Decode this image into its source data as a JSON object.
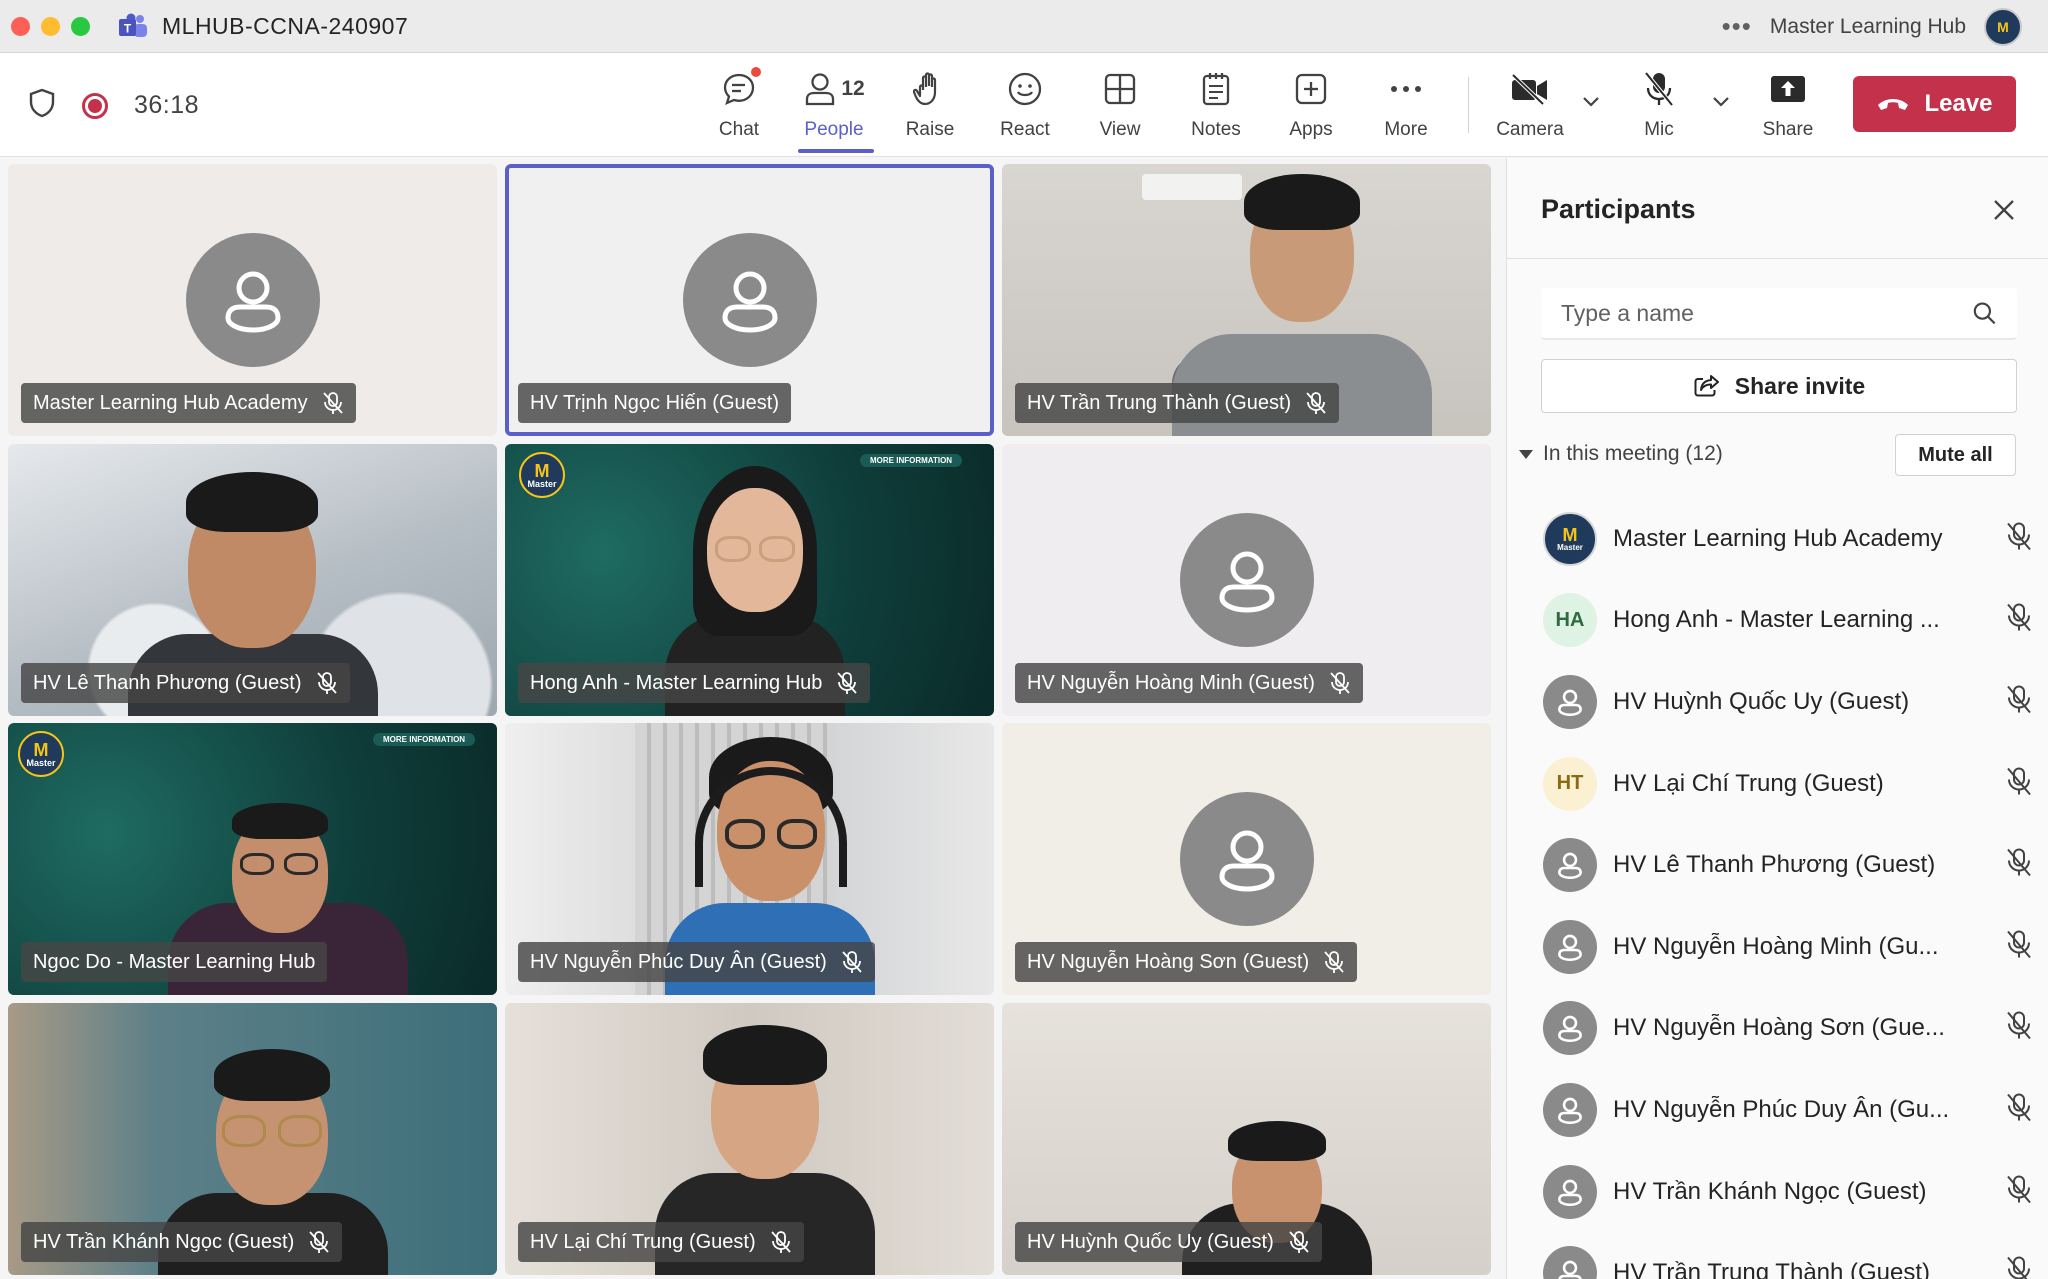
{
  "window": {
    "title": "MLHUB-CCNA-240907",
    "org_name": "Master Learning Hub",
    "more_glyph": "•••"
  },
  "toolbar": {
    "timer": "36:18",
    "chat": "Chat",
    "people": "People",
    "people_count": "12",
    "raise": "Raise",
    "react": "React",
    "view": "View",
    "notes": "Notes",
    "apps": "Apps",
    "more": "More",
    "camera": "Camera",
    "mic": "Mic",
    "share": "Share",
    "leave": "Leave"
  },
  "tiles": [
    {
      "name": "Master Learning Hub Academy",
      "kind": "avatar",
      "bg": "#efebe8"
    },
    {
      "name": "HV Trịnh Ngọc Hiến (Guest)",
      "kind": "avatar",
      "bg": "#f1f0f0"
    },
    {
      "name": "HV Trần Trung Thành (Guest)",
      "kind": "video",
      "bg": "#c9c6c1"
    },
    {
      "name": "HV Lê Thanh Phương (Guest)",
      "kind": "video",
      "bg": "#b9c2c9"
    },
    {
      "name": "Hong Anh - Master Learning Hub",
      "kind": "video",
      "bg": "#0f3d3a"
    },
    {
      "name": "HV Nguyễn Hoàng Minh (Guest)",
      "kind": "avatar",
      "bg": "#efedf0"
    },
    {
      "name": "Ngoc Do - Master Learning Hub",
      "kind": "video",
      "bg": "#0f3d3a"
    },
    {
      "name": "HV Nguyễn Phúc Duy Ân (Guest)",
      "kind": "video",
      "bg": "#d8d8d6"
    },
    {
      "name": "HV Nguyễn Hoàng Sơn (Guest)",
      "kind": "avatar",
      "bg": "#f1eee8"
    },
    {
      "name": "HV Trần Khánh Ngọc (Guest)",
      "kind": "video",
      "bg": "#3c6e7a"
    },
    {
      "name": "HV Lại Chí Trung (Guest)",
      "kind": "video",
      "bg": "#d6d1ca"
    },
    {
      "name": "HV Huỳnh Quốc Uy (Guest)",
      "kind": "video",
      "bg": "#d9d5cf"
    }
  ],
  "tile_brand": {
    "logo_letter": "M",
    "logo_text": "Master",
    "info_header": "MORE INFORMATION"
  },
  "panel": {
    "title": "Participants",
    "search_placeholder": "Type a name",
    "share_invite": "Share invite",
    "in_meeting": "In this meeting (12)",
    "mute_all": "Mute all",
    "participants": [
      {
        "name": "Master Learning Hub Academy",
        "avatar": "logo",
        "initials": "Master"
      },
      {
        "name": "Hong Anh - Master Learning ...",
        "avatar": "ha",
        "initials": "HA"
      },
      {
        "name": "HV Huỳnh Quốc Uy (Guest)",
        "avatar": "generic",
        "initials": ""
      },
      {
        "name": "HV Lại Chí Trung (Guest)",
        "avatar": "ht",
        "initials": "HT"
      },
      {
        "name": "HV Lê Thanh Phương (Guest)",
        "avatar": "generic",
        "initials": ""
      },
      {
        "name": "HV Nguyễn Hoàng Minh (Gu...",
        "avatar": "generic",
        "initials": ""
      },
      {
        "name": "HV Nguyễn Hoàng Sơn (Gue...",
        "avatar": "generic",
        "initials": ""
      },
      {
        "name": "HV Nguyễn Phúc Duy Ân (Gu...",
        "avatar": "generic",
        "initials": ""
      },
      {
        "name": "HV Trần Khánh Ngọc (Guest)",
        "avatar": "generic",
        "initials": ""
      },
      {
        "name": "HV Trần Trung Thành (Guest)",
        "avatar": "generic",
        "initials": ""
      }
    ]
  },
  "colors": {
    "accent": "#5b5fc7",
    "leave": "#c4314b",
    "record": "#c4314b"
  }
}
